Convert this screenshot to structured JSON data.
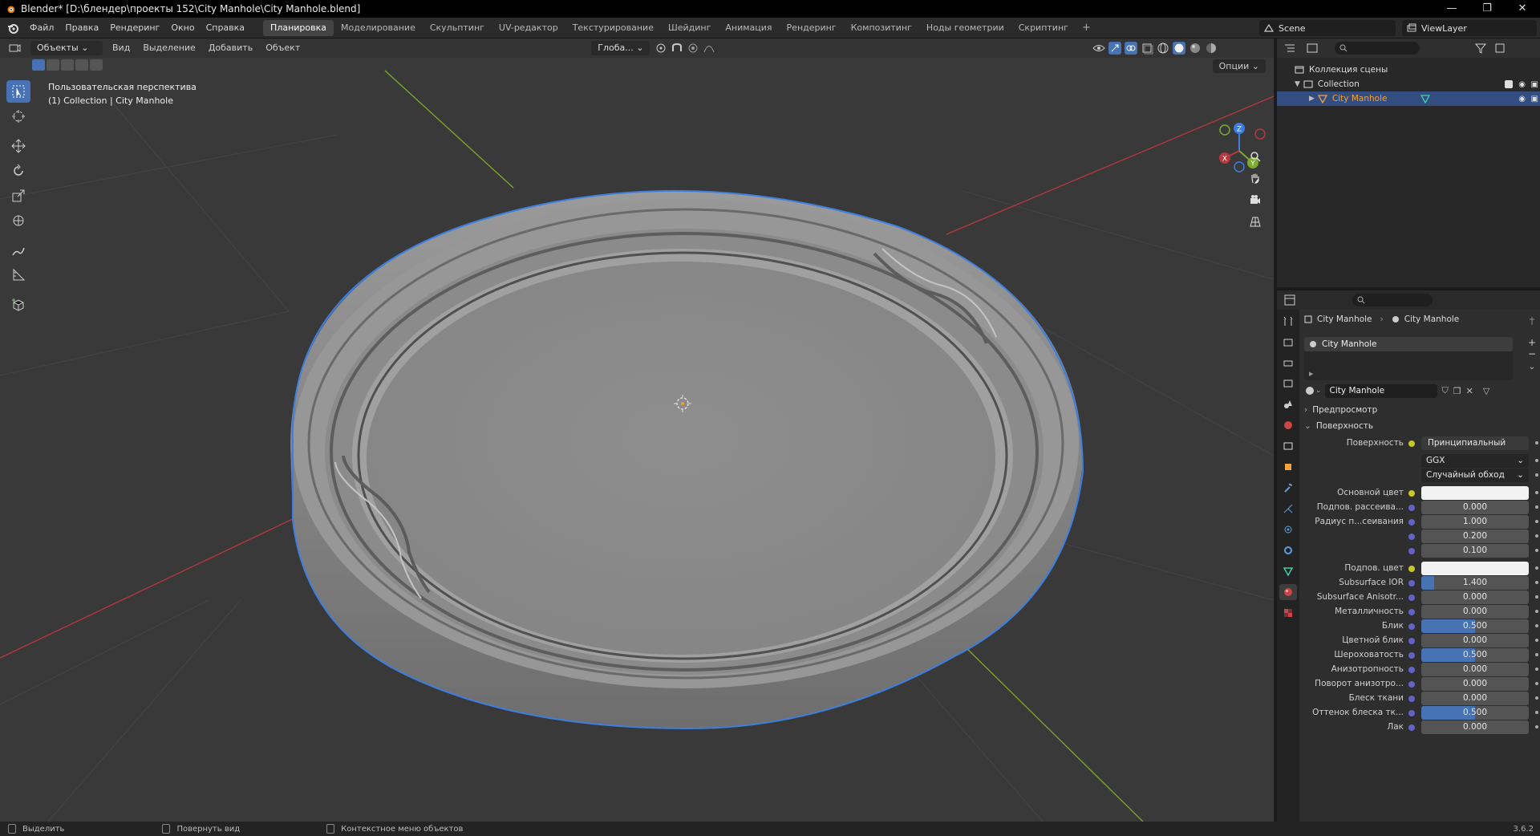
{
  "window": {
    "title": "Blender* [D:\\блендер\\проекты 152\\City Manhole\\City Manhole.blend]",
    "minimize": "—",
    "restore": "❐",
    "close": "✕"
  },
  "menu": {
    "items": [
      "Файл",
      "Правка",
      "Рендеринг",
      "Окно",
      "Справка"
    ],
    "workspaces": [
      "Планировка",
      "Моделирование",
      "Скульптинг",
      "UV-редактор",
      "Текстурирование",
      "Шейдинг",
      "Анимация",
      "Рендеринг",
      "Композитинг",
      "Ноды геометрии",
      "Скриптинг"
    ],
    "active_workspace": 0,
    "add_tab": "+",
    "scene": "Scene",
    "view_layer": "ViewLayer"
  },
  "viewport": {
    "mode": "Объекты",
    "menus": [
      "Вид",
      "Выделение",
      "Добавить",
      "Объект"
    ],
    "transform_orientation": "Глоба...",
    "options": "Опции",
    "overlay_line1": "Пользовательская перспектива",
    "overlay_line2": "(1) Collection | City Manhole",
    "gizmo_axes": [
      "X",
      "Y",
      "Z"
    ]
  },
  "outliner": {
    "scene_collection": "Коллекция сцены",
    "collection": "Collection",
    "object": "City Manhole"
  },
  "properties": {
    "breadcrumb_object": "City Manhole",
    "breadcrumb_material": "City Manhole",
    "slot_name": "City Manhole",
    "material_name": "City Manhole",
    "preview_panel": "Предпросмотр",
    "surface_panel": "Поверхность",
    "rows": [
      {
        "label": "Поверхность",
        "value": "Принципиальный BSDF",
        "kind": "shader"
      },
      {
        "label": "",
        "value": "GGX",
        "kind": "dropdown"
      },
      {
        "label": "",
        "value": "Случайный обход",
        "kind": "dropdown"
      },
      {
        "label": "Основной цвет",
        "value": "",
        "kind": "color"
      },
      {
        "label": "Подпов. рассеива...",
        "value": "0.000",
        "kind": "number",
        "fill": 0
      },
      {
        "label": "Радиус п...сеивания",
        "value": "1.000",
        "kind": "number",
        "fill": 0
      },
      {
        "label": "",
        "value": "0.200",
        "kind": "number",
        "fill": 0
      },
      {
        "label": "",
        "value": "0.100",
        "kind": "number",
        "fill": 0
      },
      {
        "label": "Подпов. цвет",
        "value": "",
        "kind": "color"
      },
      {
        "label": "Subsurface IOR",
        "value": "1.400",
        "kind": "number",
        "fill": 0.12
      },
      {
        "label": "Subsurface Anisotr...",
        "value": "0.000",
        "kind": "number",
        "fill": 0
      },
      {
        "label": "Металличность",
        "value": "0.000",
        "kind": "number",
        "fill": 0
      },
      {
        "label": "Блик",
        "value": "0.500",
        "kind": "number",
        "fill": 0.5
      },
      {
        "label": "Цветной блик",
        "value": "0.000",
        "kind": "number",
        "fill": 0
      },
      {
        "label": "Шероховатость",
        "value": "0.500",
        "kind": "number",
        "fill": 0.5
      },
      {
        "label": "Анизотропность",
        "value": "0.000",
        "kind": "number",
        "fill": 0
      },
      {
        "label": "Поворот анизотро...",
        "value": "0.000",
        "kind": "number",
        "fill": 0
      },
      {
        "label": "Блеск ткани",
        "value": "0.000",
        "kind": "number",
        "fill": 0
      },
      {
        "label": "Оттенок блеска тк...",
        "value": "0.500",
        "kind": "number",
        "fill": 0.5
      },
      {
        "label": "Лак",
        "value": "0.000",
        "kind": "number",
        "fill": 0
      }
    ]
  },
  "status": {
    "select": "Выделить",
    "rotate_view": "Повернуть вид",
    "context_menu": "Контекстное меню объектов",
    "version": "3.6.2"
  },
  "colors": {
    "accent": "#4772b3",
    "selection_outline": "#3d7fe0",
    "x_axis": "#b8383f",
    "y_axis": "#7cab2e",
    "z_axis": "#3c7de0"
  }
}
